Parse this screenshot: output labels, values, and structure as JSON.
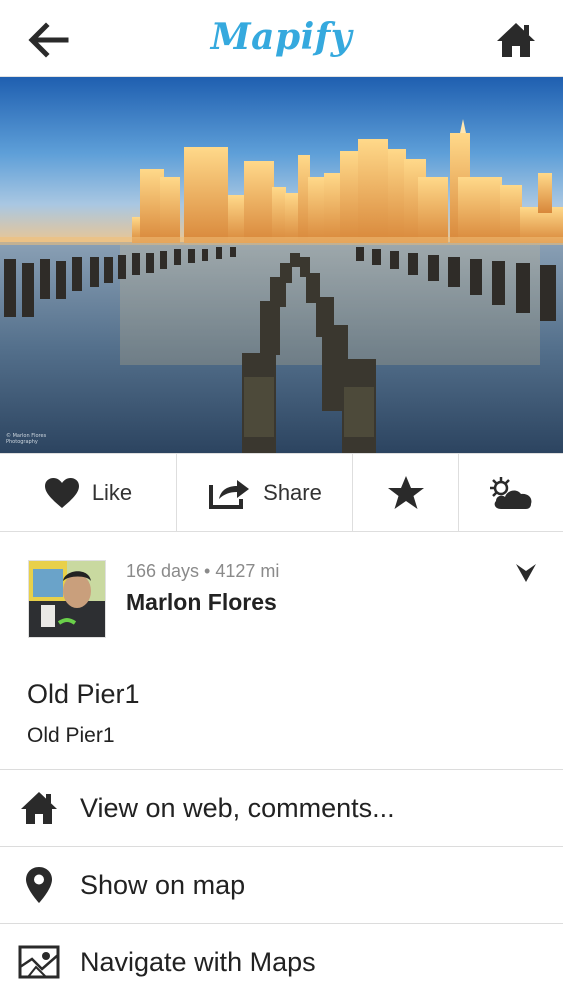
{
  "header": {
    "logo": "Mapify",
    "back_icon": "arrow-left-icon",
    "home_icon": "home-icon"
  },
  "photo": {
    "credit_line1": "© Marlon Flores",
    "credit_line2": "Photography"
  },
  "actions": {
    "like_label": "Like",
    "share_label": "Share",
    "favorite_icon": "star-icon",
    "weather_icon": "sun-cloud-icon"
  },
  "author": {
    "meta": "166 days • 4127 mi",
    "name": "Marlon Flores"
  },
  "spot": {
    "title": "Old Pier1",
    "description": "Old Pier1"
  },
  "menu": [
    {
      "label": "View on web, comments...",
      "icon": "home-icon"
    },
    {
      "label": "Show on map",
      "icon": "map-pin-icon"
    },
    {
      "label": "Navigate with Maps",
      "icon": "map-icon"
    }
  ],
  "colors": {
    "brand": "#35a9de",
    "text": "#222222",
    "muted": "#8a8a8a",
    "divider": "#dcdcdc"
  }
}
